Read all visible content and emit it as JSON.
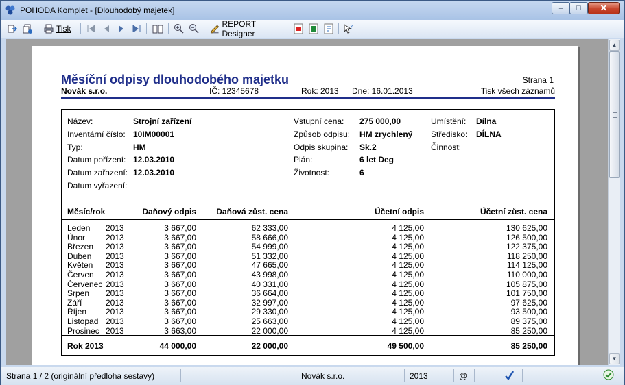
{
  "window": {
    "title": "POHODA Komplet - [Dlouhodobý majetek]",
    "min_label": "–",
    "max_label": "□",
    "close_label": "✕"
  },
  "toolbar": {
    "print_label": "Tisk",
    "report_designer_label": "REPORT Designer",
    "icons": [
      "export-icon",
      "export-multi-icon",
      "print-icon",
      "first-icon",
      "prev-icon",
      "next-icon",
      "last-icon",
      "book-icon",
      "zoom-in-icon",
      "zoom-out-icon",
      "report-designer-icon",
      "pdf-icon",
      "excel-icon",
      "attachment-icon",
      "help-pointer-icon"
    ]
  },
  "report": {
    "title": "Měsíční odpisy dlouhodobého majetku",
    "page_label": "Strana 1",
    "company": "Novák s.r.o.",
    "ico": "IČ: 12345678",
    "year": "Rok: 2013",
    "date": "Dne: 16.01.2013",
    "print_scope": "Tisk všech záznamů",
    "fields": {
      "nazev_label": "Název:",
      "nazev_value": "Strojní zařízení",
      "inv_label": "Inventární číslo:",
      "inv_value": "10IM00001",
      "typ_label": "Typ:",
      "typ_value": "HM",
      "porizeni_label": "Datum pořízení:",
      "porizeni_value": "12.03.2010",
      "zarazeni_label": "Datum zařazení:",
      "zarazeni_value": "12.03.2010",
      "vyrazeni_label": "Datum vyřazení:",
      "vyrazeni_value": "",
      "vstupni_label": "Vstupní cena:",
      "vstupni_value": "275 000,00",
      "zpusob_label": "Způsob odpisu:",
      "zpusob_value": "HM zrychlený",
      "skupina_label": "Odpis skupina:",
      "skupina_value": "Sk.2",
      "plan_label": "Plán:",
      "plan_value": "6 let Deg",
      "zivotnost_label": "Životnost:",
      "zivotnost_value": "6",
      "umisteni_label": "Umístění:",
      "umisteni_value": "Dílna",
      "stredisko_label": "Středisko:",
      "stredisko_value": "DÍLNA",
      "cinnost_label": "Činnost:",
      "cinnost_value": ""
    },
    "columns": {
      "month": "Měsíc/rok",
      "tax_dep": "Daňový odpis",
      "tax_res": "Daňová zůst. cena",
      "acc_dep": "Účetní odpis",
      "acc_res": "Účetní zůst. cena"
    },
    "rows": [
      {
        "m": "Leden",
        "y": "2013",
        "td": "3 667,00",
        "tr": "62 333,00",
        "ad": "4 125,00",
        "ar": "130 625,00"
      },
      {
        "m": "Únor",
        "y": "2013",
        "td": "3 667,00",
        "tr": "58 666,00",
        "ad": "4 125,00",
        "ar": "126 500,00"
      },
      {
        "m": "Březen",
        "y": "2013",
        "td": "3 667,00",
        "tr": "54 999,00",
        "ad": "4 125,00",
        "ar": "122 375,00"
      },
      {
        "m": "Duben",
        "y": "2013",
        "td": "3 667,00",
        "tr": "51 332,00",
        "ad": "4 125,00",
        "ar": "118 250,00"
      },
      {
        "m": "Květen",
        "y": "2013",
        "td": "3 667,00",
        "tr": "47 665,00",
        "ad": "4 125,00",
        "ar": "114 125,00"
      },
      {
        "m": "Červen",
        "y": "2013",
        "td": "3 667,00",
        "tr": "43 998,00",
        "ad": "4 125,00",
        "ar": "110 000,00"
      },
      {
        "m": "Červenec",
        "y": "2013",
        "td": "3 667,00",
        "tr": "40 331,00",
        "ad": "4 125,00",
        "ar": "105 875,00"
      },
      {
        "m": "Srpen",
        "y": "2013",
        "td": "3 667,00",
        "tr": "36 664,00",
        "ad": "4 125,00",
        "ar": "101 750,00"
      },
      {
        "m": "Září",
        "y": "2013",
        "td": "3 667,00",
        "tr": "32 997,00",
        "ad": "4 125,00",
        "ar": "97 625,00"
      },
      {
        "m": "Říjen",
        "y": "2013",
        "td": "3 667,00",
        "tr": "29 330,00",
        "ad": "4 125,00",
        "ar": "93 500,00"
      },
      {
        "m": "Listopad",
        "y": "2013",
        "td": "3 667,00",
        "tr": "25 663,00",
        "ad": "4 125,00",
        "ar": "89 375,00"
      },
      {
        "m": "Prosinec",
        "y": "2013",
        "td": "3 663,00",
        "tr": "22 000,00",
        "ad": "4 125,00",
        "ar": "85 250,00"
      }
    ],
    "total": {
      "label": "Rok 2013",
      "td": "44 000,00",
      "tr": "22 000,00",
      "ad": "49 500,00",
      "ar": "85 250,00"
    }
  },
  "status": {
    "page_info": "Strana 1 / 2  (originální předloha sestavy)",
    "company": "Novák  s.r.o.",
    "year": "2013",
    "at": "@"
  }
}
